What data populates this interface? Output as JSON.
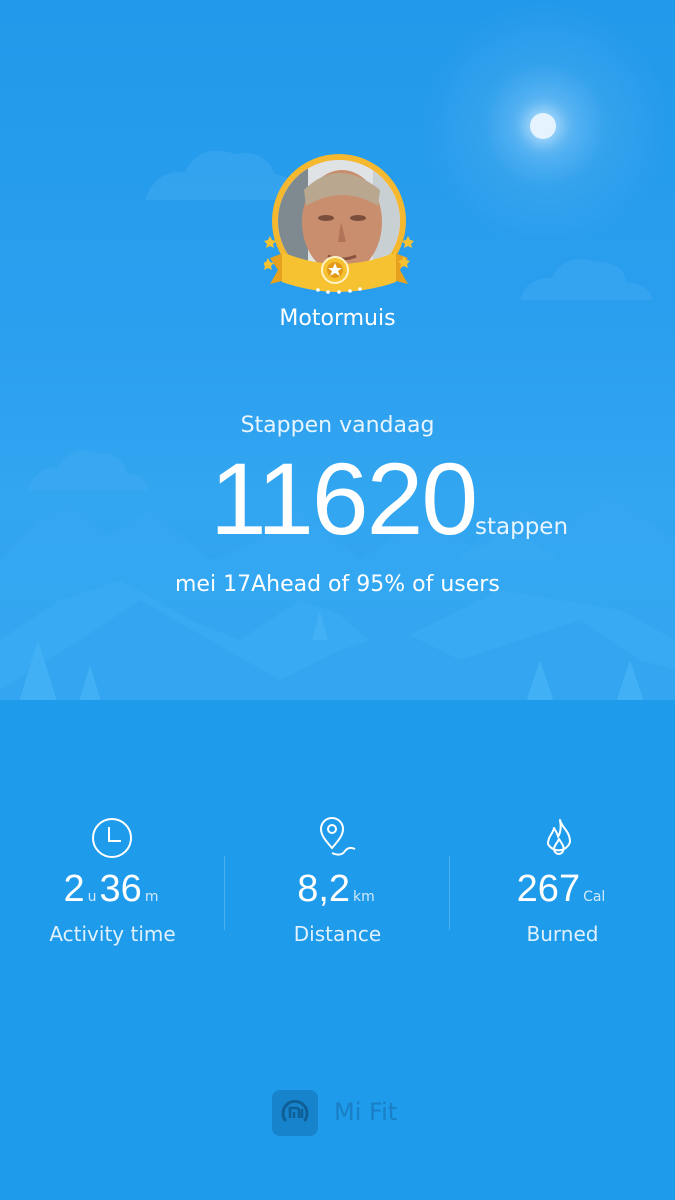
{
  "profile": {
    "name": "Motormuis"
  },
  "steps": {
    "label": "Stappen vandaag",
    "count": "11620",
    "unit": "stappen",
    "date": "mei 17",
    "ranking": "Ahead of 95% of users"
  },
  "stats": {
    "activity": {
      "hours": "2",
      "hours_unit": "u",
      "minutes": "36",
      "minutes_unit": "m",
      "caption": "Activity time",
      "icon": "clock-icon"
    },
    "distance": {
      "value": "8,2",
      "unit": "km",
      "caption": "Distance",
      "icon": "location-pin-icon"
    },
    "burned": {
      "value": "267",
      "unit": "Cal",
      "caption": "Burned",
      "icon": "flame-icon"
    }
  },
  "app": {
    "name": "Mi Fit",
    "icon": "mi-fit-logo-icon"
  },
  "colors": {
    "background": "#1e9bea",
    "medal_gold": "#f5b82e",
    "logo": "#1783cc"
  }
}
